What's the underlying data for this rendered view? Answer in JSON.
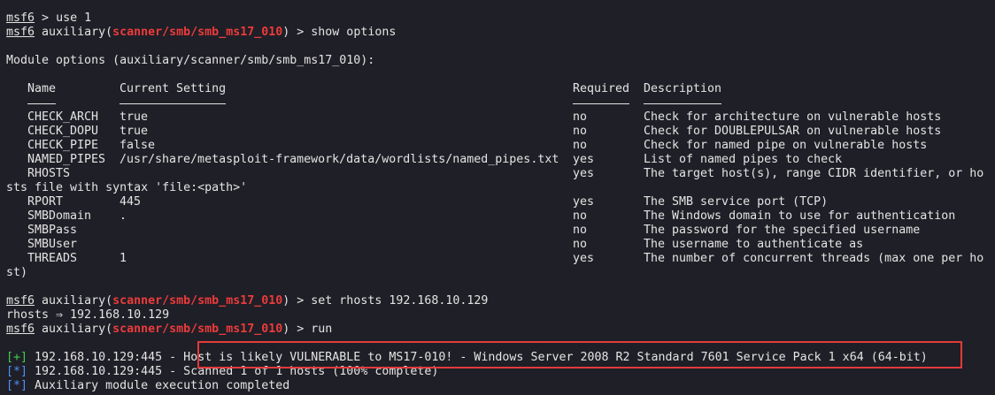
{
  "prompt": {
    "name": "msf6",
    "prefix": "auxiliary(",
    "module": "scanner/smb/smb_ms17_010",
    "suffix": ") > "
  },
  "lines": {
    "l1_cmd": "use 1",
    "l2_cmd": "show options",
    "module_options_title": "Module options (auxiliary/scanner/smb/smb_ms17_010):",
    "headers": {
      "name": "Name",
      "current_setting": "Current Setting",
      "required": "Required",
      "description": "Description"
    },
    "options": [
      {
        "name": "CHECK_ARCH",
        "value": "true",
        "required": "no",
        "description": "Check for architecture on vulnerable hosts"
      },
      {
        "name": "CHECK_DOPU",
        "value": "true",
        "required": "no",
        "description": "Check for DOUBLEPULSAR on vulnerable hosts"
      },
      {
        "name": "CHECK_PIPE",
        "value": "false",
        "required": "no",
        "description": "Check for named pipe on vulnerable hosts"
      },
      {
        "name": "NAMED_PIPES",
        "value": "/usr/share/metasploit-framework/data/wordlists/named_pipes.txt",
        "required": "yes",
        "description": "List of named pipes to check"
      },
      {
        "name": "RHOSTS",
        "value": "",
        "required": "yes",
        "description": "The target host(s), range CIDR identifier, or ho"
      },
      {
        "name": "RPORT",
        "value": "445",
        "required": "yes",
        "description": "The SMB service port (TCP)"
      },
      {
        "name": "SMBDomain",
        "value": ".",
        "required": "no",
        "description": "The Windows domain to use for authentication"
      },
      {
        "name": "SMBPass",
        "value": "",
        "required": "no",
        "description": "The password for the specified username"
      },
      {
        "name": "SMBUser",
        "value": "",
        "required": "no",
        "description": "The username to authenticate as"
      },
      {
        "name": "THREADS",
        "value": "1",
        "required": "yes",
        "description": "The number of concurrent threads (max one per ho"
      }
    ],
    "rhosts_wrap": "sts file with syntax 'file:<path>'",
    "threads_wrap": "st)",
    "set_cmd": "set rhosts 192.168.10.129",
    "rhosts_result": "rhosts ⇒ 192.168.10.129",
    "run_cmd": "run",
    "result_plus_tag": "[+]",
    "result_plus_host": "192.168.10.129:445",
    "result_plus_msg": "- Host is likely VULNERABLE to MS17-010! - Windows Server 2008 R2 Standard 7601 Service Pack 1 x64 (64-bit)",
    "result_star1_tag": "[*]",
    "result_star1_host": "192.168.10.129:445",
    "result_star1_msg": "- Scanned 1 of 1 hosts (100% complete)",
    "result_star2_tag": "[*]",
    "result_star2_msg": "Auxiliary module execution completed"
  },
  "colors": {
    "background": "#1f1f27",
    "text": "#e4e4e4",
    "module_red": "#ec3b3b",
    "info_blue": "#4f8ff7",
    "success_green": "#3ccf4c",
    "highlight_box": "#e23b3b"
  }
}
